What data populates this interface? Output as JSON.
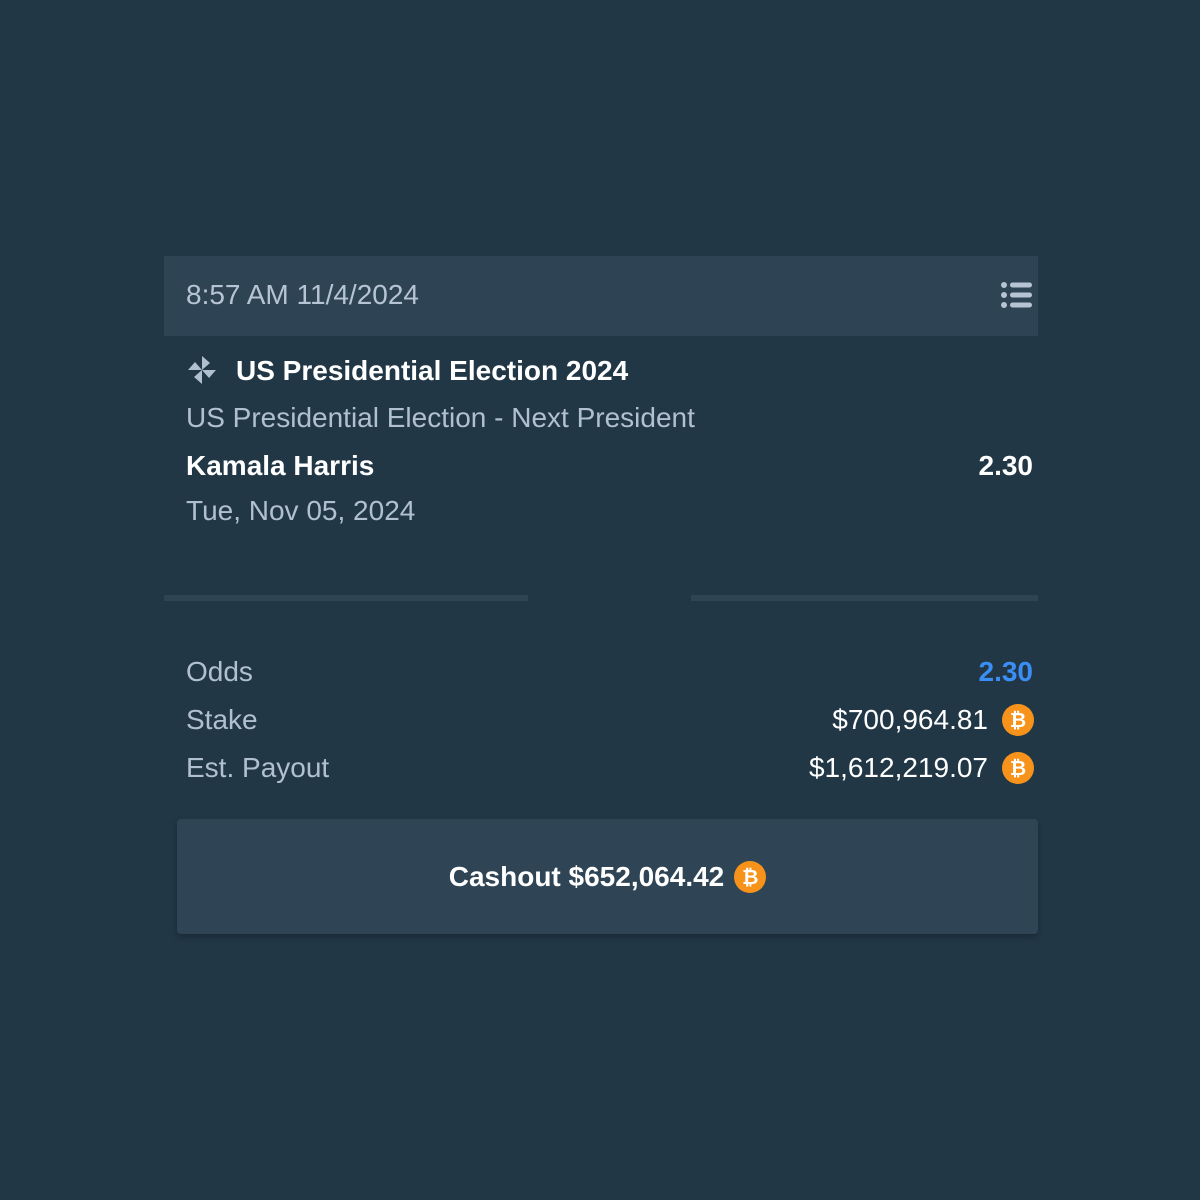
{
  "header": {
    "timestamp": "8:57 AM 11/4/2024"
  },
  "bet": {
    "event_title": "US Presidential Election 2024",
    "market": "US Presidential Election - Next President",
    "selection": "Kamala Harris",
    "selection_odds": "2.30",
    "event_date": "Tue, Nov 05, 2024"
  },
  "summary": {
    "odds_label": "Odds",
    "odds_value": "2.30",
    "stake_label": "Stake",
    "stake_value": "$700,964.81",
    "payout_label": "Est. Payout",
    "payout_value": "$1,612,219.07"
  },
  "cashout": {
    "label": "Cashout $652,064.42"
  },
  "currency": {
    "symbol": "₿",
    "icon": "bitcoin-icon"
  },
  "colors": {
    "background": "#213746",
    "header": "#2e4454",
    "odds_accent": "#3b8ef5",
    "bitcoin": "#f7931a"
  }
}
